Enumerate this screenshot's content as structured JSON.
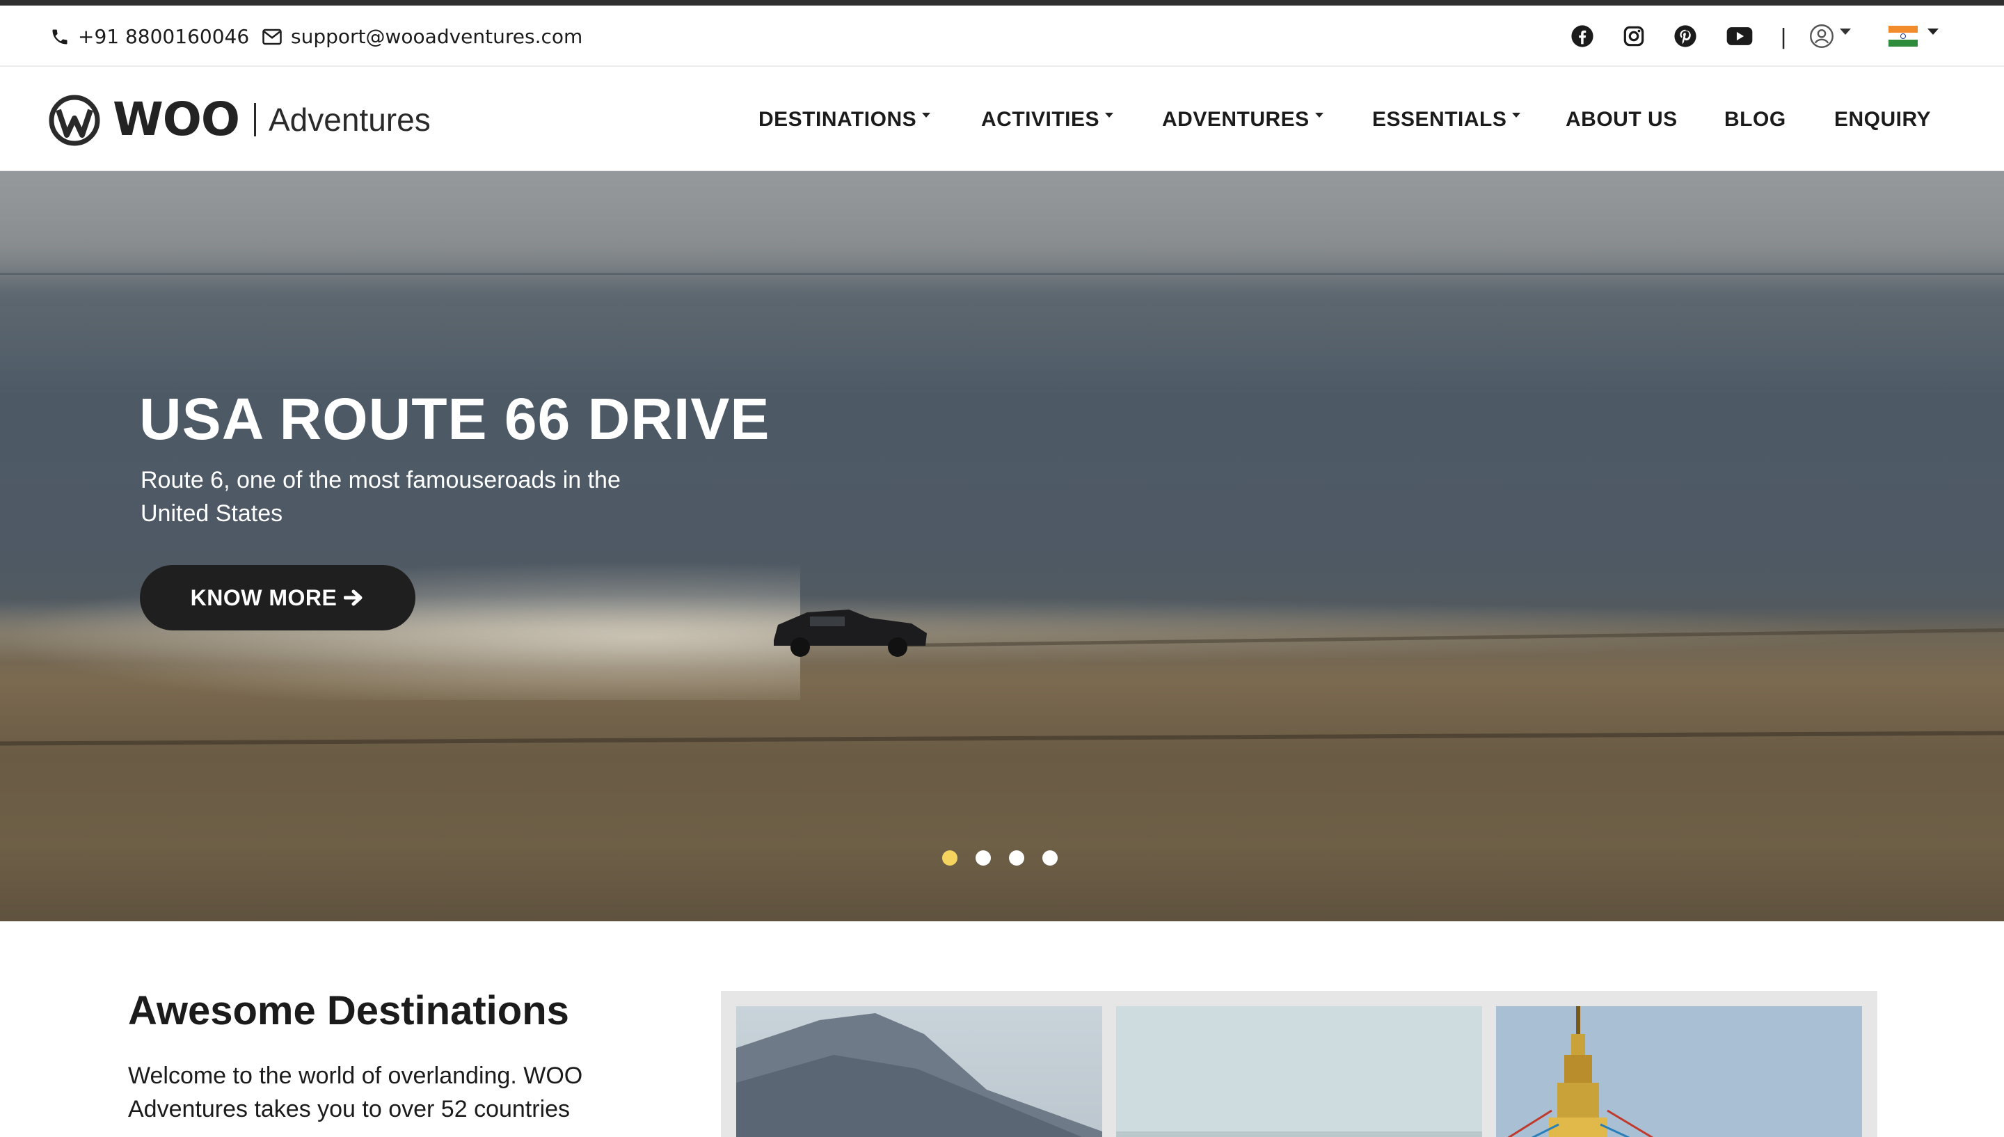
{
  "topbar": {
    "phone": "+91 8800160046",
    "email": "support@wooadventures.com",
    "social_icons": [
      "facebook-icon",
      "instagram-icon",
      "pinterest-icon",
      "youtube-icon"
    ],
    "separator": "|",
    "user_icon": "user-circle-icon",
    "language_flag": "india-flag-icon"
  },
  "header": {
    "logo_wordmark": "WOO",
    "logo_tagline": "Adventures",
    "nav": [
      {
        "label": "DESTINATIONS",
        "has_dropdown": true
      },
      {
        "label": "ACTIVITIES",
        "has_dropdown": true
      },
      {
        "label": "ADVENTURES",
        "has_dropdown": true
      },
      {
        "label": "ESSENTIALS",
        "has_dropdown": true
      },
      {
        "label": "ABOUT US",
        "has_dropdown": false
      },
      {
        "label": "BLOG",
        "has_dropdown": false
      },
      {
        "label": "ENQUIRY",
        "has_dropdown": false
      }
    ]
  },
  "hero": {
    "title": "USA ROUTE 66 DRIVE",
    "subtitle": "Route 6, one of the most famouseroads in the United States",
    "cta_label": "KNOW MORE",
    "cta_icon": "arrow-right-icon",
    "slide_count": 4,
    "active_slide": 1
  },
  "destinations": {
    "title": "Awesome Destinations",
    "body": "Welcome to the world of overlanding. WOO Adventures takes you to over 52 countries"
  },
  "colors": {
    "text": "#1b1b1b",
    "button_bg": "#1f1f1f",
    "dot_active": "#f4d35e",
    "dot_inactive": "#ffffff"
  }
}
